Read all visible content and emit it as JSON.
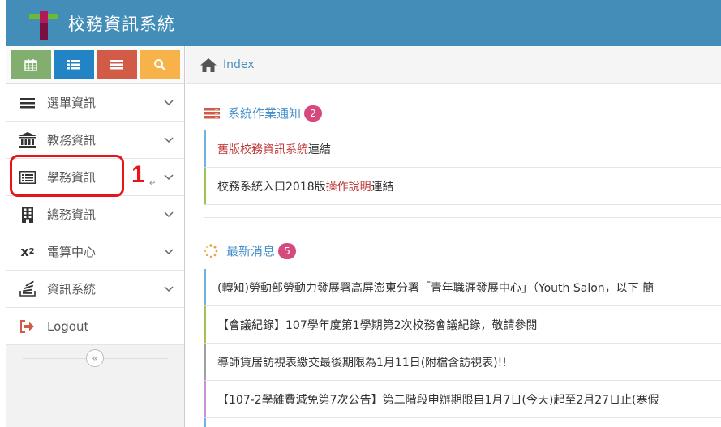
{
  "header": {
    "title": "校務資訊系統",
    "bg_color": "#438eb9"
  },
  "shortcuts": [
    {
      "icon": "calendar-icon",
      "color": "#82af6f"
    },
    {
      "icon": "list-icon",
      "color": "#2283c5"
    },
    {
      "icon": "menu-icon",
      "color": "#d15b47"
    },
    {
      "icon": "search-icon",
      "color": "#f8b24a"
    }
  ],
  "sidebar": {
    "items": [
      {
        "label": "選單資訊",
        "icon": "menu-bars-icon"
      },
      {
        "label": "教務資訊",
        "icon": "bank-icon"
      },
      {
        "label": "學務資訊",
        "icon": "card-list-icon"
      },
      {
        "label": "總務資訊",
        "icon": "building-icon"
      },
      {
        "label": "電算中心",
        "icon": "superscript-icon"
      },
      {
        "label": "資訊系統",
        "icon": "stack-icon"
      }
    ],
    "logout": "Logout",
    "collapse": "«"
  },
  "annotation": {
    "number": "1",
    "mark": "↵"
  },
  "breadcrumb": {
    "label": "Index",
    "icon": "home-icon"
  },
  "notices": {
    "title": "系統作業通知",
    "count": "2",
    "items": [
      {
        "red": "舊版校務資訊系統",
        "text": "連結"
      },
      {
        "prefix": "校務系統入口2018版",
        "red": "操作說明",
        "text": "連結"
      }
    ]
  },
  "news": {
    "title": "最新消息",
    "count": "5",
    "items": [
      "(轉知)勞動部勞動力發展署高屏澎東分署「青年職涯發展中心」（Youth Salon，以下 簡",
      "【會議紀錄】107學年度第1學期第2次校務會議紀錄，敬請參閱",
      "導師賃居訪視表繳交最後期限為1月11日(附檔含訪視表)!!",
      "【107-2學雜費減免第7次公告】第二階段申辦期限自1月7日(今天)起至2月27日止(寒假"
    ]
  }
}
